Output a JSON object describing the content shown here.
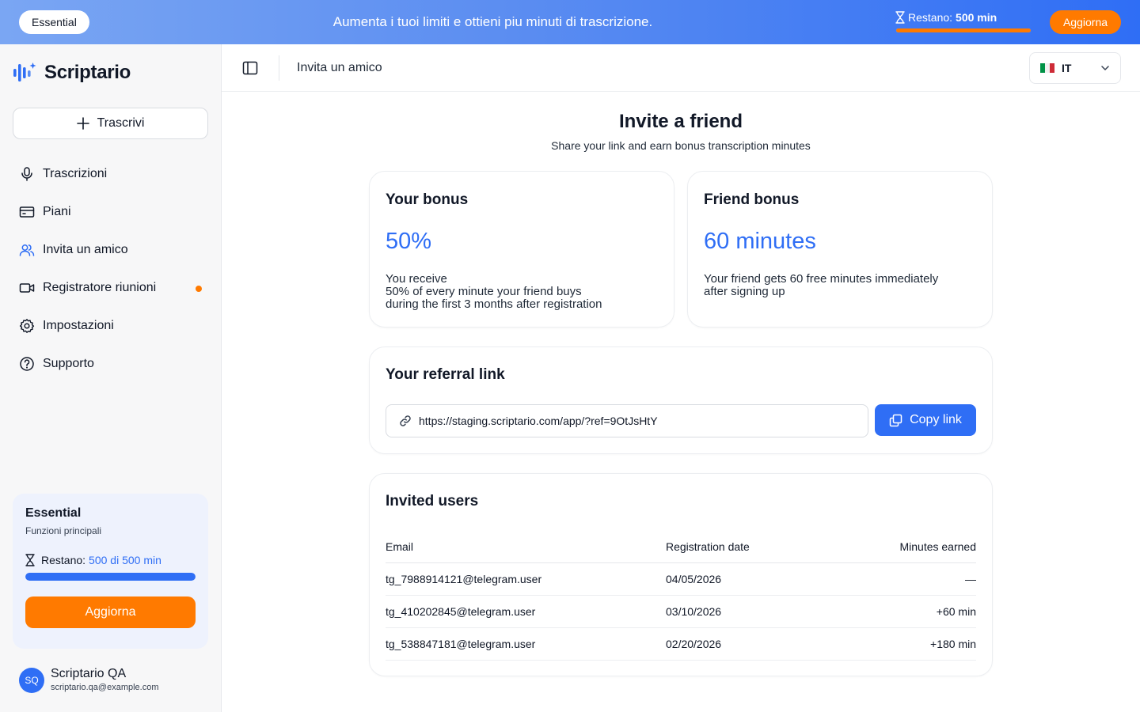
{
  "banner": {
    "plan": "Essential",
    "message": "Aumenta i tuoi limiti e ottieni piu minuti di trascrizione.",
    "remaining_label": "Restano:",
    "remaining_value": "500 min",
    "remaining_fraction": 1.0,
    "upgrade_label": "Aggiorna"
  },
  "sidebar": {
    "brand": "Scriptario",
    "new_label": "Trascrivi",
    "items": [
      {
        "label": "Trascrizioni",
        "icon": "microphone-icon"
      },
      {
        "label": "Piani",
        "icon": "card-icon"
      },
      {
        "label": "Invita un amico",
        "icon": "users-icon",
        "active": true
      },
      {
        "label": "Registratore riunioni",
        "icon": "video-icon",
        "badge_dot": true
      },
      {
        "label": "Impostazioni",
        "icon": "gear-icon"
      },
      {
        "label": "Supporto",
        "icon": "help-icon"
      }
    ],
    "plan_card": {
      "name": "Essential",
      "desc": "Funzioni principali",
      "remaining_label": "Restano:",
      "remaining_value": "500 di 500 min",
      "remaining_fraction": 1.0,
      "upgrade_label": "Aggiorna"
    },
    "user": {
      "initials": "SQ",
      "name": "Scriptario QA",
      "email": "scriptario.qa@example.com"
    }
  },
  "header": {
    "breadcrumb": "Invita un amico",
    "language": "IT"
  },
  "main": {
    "title": "Invite a friend",
    "subtitle": "Share your link and earn bonus transcription minutes",
    "your_bonus": {
      "title": "Your bonus",
      "value": "50%",
      "lines": [
        "You receive",
        "50% of every minute your friend buys",
        "during the first 3 months after registration"
      ]
    },
    "friend_bonus": {
      "title": "Friend bonus",
      "value": "60 minutes",
      "lines": [
        "Your friend gets 60 free minutes immediately",
        "after signing up"
      ]
    },
    "referral": {
      "title": "Your referral link",
      "url": "https://staging.scriptario.com/app/?ref=9OtJsHtY",
      "copy_label": "Copy link"
    },
    "invited": {
      "title": "Invited users",
      "columns": [
        "Email",
        "Registration date",
        "Minutes earned"
      ],
      "rows": [
        {
          "email": "tg_7988914121@telegram.user",
          "date": "04/05/2026",
          "minutes": "—"
        },
        {
          "email": "tg_410202845@telegram.user",
          "date": "03/10/2026",
          "minutes": "+60 min"
        },
        {
          "email": "tg_538847181@telegram.user",
          "date": "02/20/2026",
          "minutes": "+180 min"
        }
      ]
    }
  },
  "colors": {
    "accent": "#2f6ef5",
    "orange": "#ff7a00",
    "banner_from": "#7aa6f3",
    "banner_to": "#2f6ef5"
  }
}
